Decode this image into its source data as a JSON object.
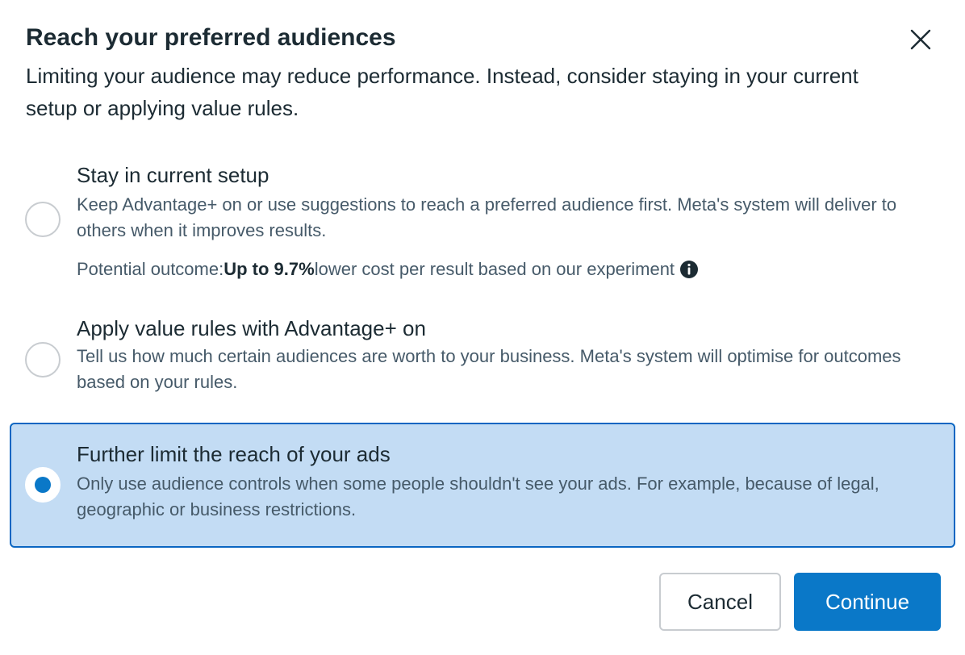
{
  "dialog": {
    "title": "Reach your preferred audiences",
    "subtitle": "Limiting your audience may reduce performance. Instead, consider staying in your current setup or applying value rules.",
    "close_icon": "close-icon"
  },
  "options": [
    {
      "title": "Stay in current setup",
      "description": "Keep Advantage+ on or use suggestions to reach a preferred audience first. Meta's system will deliver to others when it improves results.",
      "outcome_prefix": "Potential outcome: ",
      "outcome_bold": "Up to 9.7%",
      "outcome_suffix": " lower cost per result based on our experiment",
      "info_icon": "info-icon",
      "selected": false
    },
    {
      "title": "Apply value rules with Advantage+ on",
      "description": "Tell us how much certain audiences are worth to your business. Meta's system will optimise for outcomes based on your rules.",
      "selected": false
    },
    {
      "title": "Further limit the reach of your ads",
      "description": "Only use audience controls when some people shouldn't see your ads. For example, because of legal, geographic or business restrictions.",
      "selected": true
    }
  ],
  "footer": {
    "cancel_label": "Cancel",
    "continue_label": "Continue"
  },
  "colors": {
    "accent": "#0a78c8",
    "selected_bg": "#c3dcf4",
    "selected_border": "#0a66c2"
  }
}
